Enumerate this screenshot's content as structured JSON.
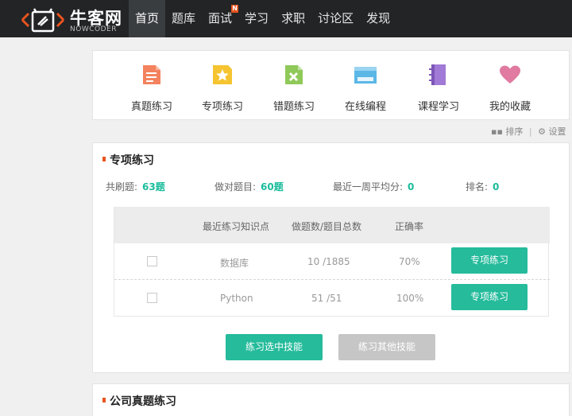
{
  "brand": {
    "name": "牛客网",
    "sub": "NOWCODER",
    "accent": "#e8541e"
  },
  "nav": [
    {
      "label": "首页",
      "active": true
    },
    {
      "label": "题库"
    },
    {
      "label": "面试",
      "badge": "N"
    },
    {
      "label": "学习"
    },
    {
      "label": "求职"
    },
    {
      "label": "讨论区"
    },
    {
      "label": "发现"
    }
  ],
  "shortcuts": [
    {
      "label": "真题练习",
      "icon": "document-icon",
      "color": "#f4825e"
    },
    {
      "label": "专项练习",
      "icon": "star-icon",
      "color": "#f5c430"
    },
    {
      "label": "错题练习",
      "icon": "error-doc-icon",
      "color": "#8fc95a"
    },
    {
      "label": "在线编程",
      "icon": "code-window-icon",
      "color": "#5bb7e6"
    },
    {
      "label": "课程学习",
      "icon": "book-icon",
      "color": "#a07ad6"
    },
    {
      "label": "我的收藏",
      "icon": "heart-icon",
      "color": "#e07aa0"
    }
  ],
  "tools": {
    "sort": "排序",
    "divider": "|",
    "settings": "设置"
  },
  "practice": {
    "title": "专项练习",
    "stats": {
      "total_label": "共刷题:",
      "total_value": "63题",
      "correct_label": "做对题目:",
      "correct_value": "60题",
      "avg_label": "最近一周平均分:",
      "avg_value": "0",
      "rank_label": "排名:",
      "rank_value": "0"
    },
    "columns": [
      "最近练习知识点",
      "做题数/题目总数",
      "正确率"
    ],
    "rows": [
      {
        "topic": "数据库",
        "progress": "10 /1885",
        "rate": "70%",
        "button": "专项练习"
      },
      {
        "topic": "Python",
        "progress": "51 /51",
        "rate": "100%",
        "button": "专项练习"
      }
    ],
    "practice_selected": "练习选中技能",
    "practice_other": "练习其他技能"
  },
  "company": {
    "title": "公司真题练习"
  }
}
